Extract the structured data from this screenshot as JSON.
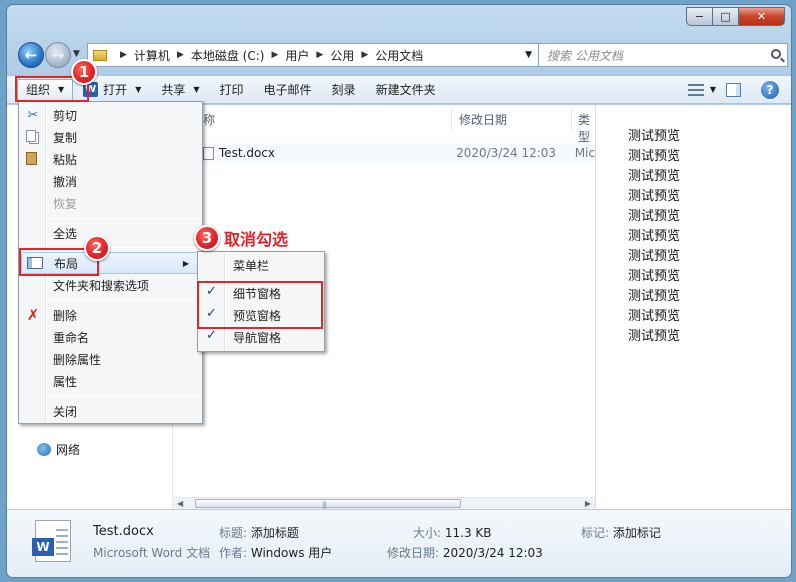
{
  "window": {
    "caption": {
      "minimize": "−",
      "maximize": "□",
      "close": "✕"
    }
  },
  "navigation": {
    "back": "←",
    "forward": "→",
    "breadcrumb": [
      "计算机",
      "本地磁盘 (C:)",
      "用户",
      "公用",
      "公用文档"
    ],
    "refresh": "⟳",
    "search_placeholder": "搜索 公用文档"
  },
  "toolbar": {
    "organize": "组织",
    "open": "打开",
    "share": "共享",
    "print": "打印",
    "email": "电子邮件",
    "burn": "刻录",
    "new_folder": "新建文件夹",
    "help": "?"
  },
  "file_list": {
    "columns": {
      "name": "称",
      "date": "修改日期",
      "type": "类型"
    },
    "files": [
      {
        "name": "Test.docx",
        "date": "2020/3/24 12:03",
        "type": "Mic"
      }
    ]
  },
  "nav_pane": {
    "network": "网络"
  },
  "organize_menu": {
    "cut": "剪切",
    "copy": "复制",
    "paste": "粘贴",
    "undo": "撤消",
    "redo": "恢复",
    "select_all": "全选",
    "layout": "布局",
    "folder_options": "文件夹和搜索选项",
    "delete": "删除",
    "rename": "重命名",
    "remove_properties": "删除属性",
    "properties": "属性",
    "close": "关闭"
  },
  "layout_submenu": {
    "menu_bar": "菜单栏",
    "details_pane": "细节窗格",
    "preview_pane": "预览窗格",
    "navigation_pane": "导航窗格",
    "check": "✓"
  },
  "preview_text": [
    "测试预览",
    "测试预览",
    "测试预览",
    "测试预览",
    "测试预览",
    "测试预览",
    "测试预览",
    "测试预览",
    "测试预览",
    "测试预览",
    "测试预览"
  ],
  "details": {
    "name": "Test.docx",
    "type": "Microsoft Word 文档",
    "title_label": "标题:",
    "title_value": "添加标题",
    "author_label": "作者:",
    "author_value": "Windows 用户",
    "size_label": "大小:",
    "size_value": "11.3 KB",
    "modified_label": "修改日期:",
    "modified_value": "2020/3/24 12:03",
    "tags_label": "标记:",
    "tags_value": "添加标记"
  },
  "annotations": {
    "step1": "1",
    "step2": "2",
    "step3": "3",
    "callout": "取消勾选",
    "color": "#e3232b"
  }
}
